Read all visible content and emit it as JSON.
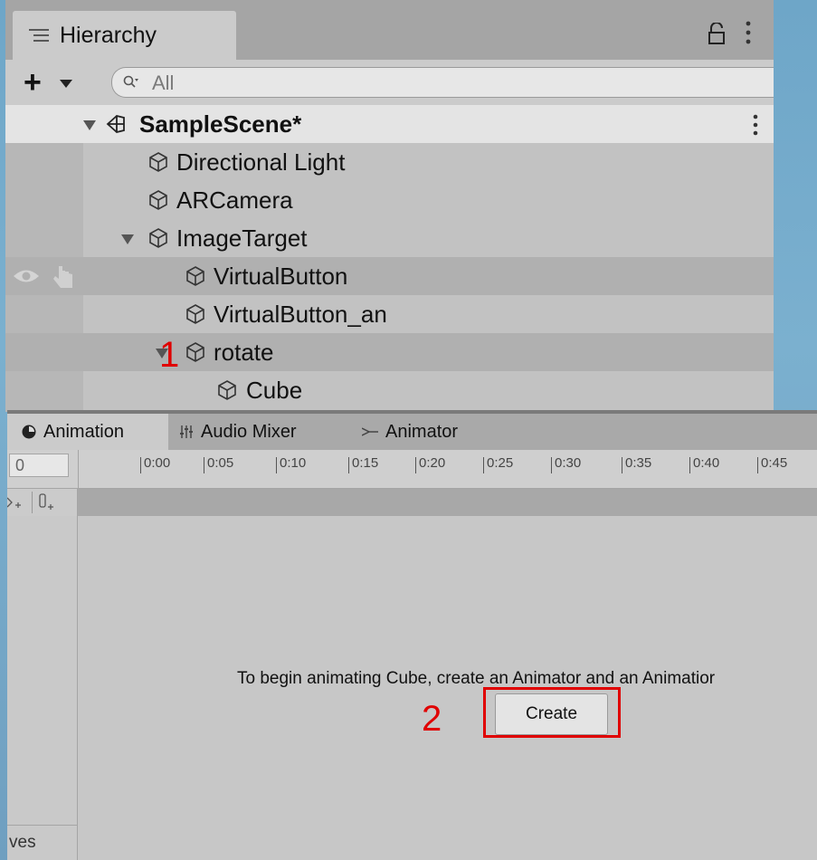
{
  "hierarchy": {
    "title": "Hierarchy",
    "search_placeholder": "All",
    "scene_name": "SampleScene*",
    "items": [
      {
        "label": "Directional Light"
      },
      {
        "label": "ARCamera"
      },
      {
        "label": "ImageTarget"
      },
      {
        "label": "VirtualButton"
      },
      {
        "label": "VirtualButton_an"
      },
      {
        "label": "rotate"
      },
      {
        "label": "Cube"
      }
    ]
  },
  "annotations": {
    "marker_1": "1",
    "marker_2": "2"
  },
  "animation": {
    "tabs": [
      {
        "label": "Animation"
      },
      {
        "label": "Audio Mixer"
      },
      {
        "label": "Animator"
      }
    ],
    "frame_value": "0",
    "timeline_ticks": [
      "0:00",
      "0:05",
      "0:10",
      "0:15",
      "0:20",
      "0:25",
      "0:30",
      "0:35",
      "0:40",
      "0:45"
    ],
    "message": "To begin animating Cube, create an Animator and an Animatior",
    "create_label": "Create",
    "curves_label": "ves"
  },
  "colors": {
    "annotation_red": "#e00000",
    "panel_bg": "#c2c2c2",
    "selected_row": "#b0b0b0"
  }
}
